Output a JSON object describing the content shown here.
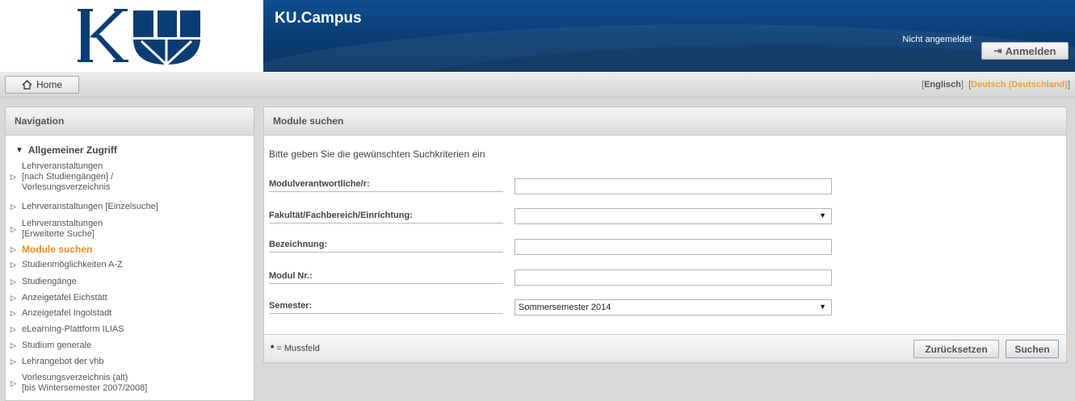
{
  "header": {
    "logo_alt": "KU",
    "app_title": "KU.Campus",
    "login_status": "Nicht angemeldet",
    "login_button": "Anmelden",
    "login_icon": "sign-in-icon",
    "brand_color": "#0c4580"
  },
  "toolbar": {
    "home_label": "Home",
    "home_icon": "home-icon",
    "lang_en": "Englisch",
    "lang_de": "Deutsch (Deutschland)",
    "active_lang_color": "#f0a030"
  },
  "nav": {
    "title": "Navigation",
    "group_title": "Allgemeiner Zugriff",
    "items": [
      {
        "label": "Lehrveranstaltungen\n[nach Studiengängen] /\nVorlesungsverzeichnis"
      },
      {
        "label": "Lehrveranstaltungen [Einzelsuche]"
      },
      {
        "label": "Lehrveranstaltungen\n[Erweiterte Suche]"
      },
      {
        "label": "Module suchen",
        "active": true
      },
      {
        "label": "Studienmöglichkeiten A-Z"
      },
      {
        "label": "Studiengänge"
      },
      {
        "label": "Anzeigetafel Eichstätt"
      },
      {
        "label": "Anzeigetafel Ingolstadt"
      },
      {
        "label": "eLearning-Plattform ILIAS"
      },
      {
        "label": "Studium generale"
      },
      {
        "label": "Lehrangebot der vhb"
      },
      {
        "label": "Vorlesungsverzeichnis (alt)\n[bis Wintersemester 2007/2008]"
      }
    ]
  },
  "main": {
    "title": "Module suchen",
    "intro": "Bitte geben Sie die gewünschten Suchkriterien ein",
    "fields": {
      "modulverantwortliche": {
        "label": "Modulverantwortliche/r:",
        "value": ""
      },
      "fakultaet": {
        "label": "Fakultät/Fachbereich/Einrichtung:",
        "value": ""
      },
      "bezeichnung": {
        "label": "Bezeichnung:",
        "value": ""
      },
      "modul_nr": {
        "label": "Modul Nr.:",
        "value": ""
      },
      "semester": {
        "label": "Semester:",
        "value": "Sommersemester 2014"
      }
    },
    "required_star": "*",
    "required_note": "= Mussfeld",
    "reset_button": "Zurücksetzen",
    "search_button": "Suchen"
  }
}
